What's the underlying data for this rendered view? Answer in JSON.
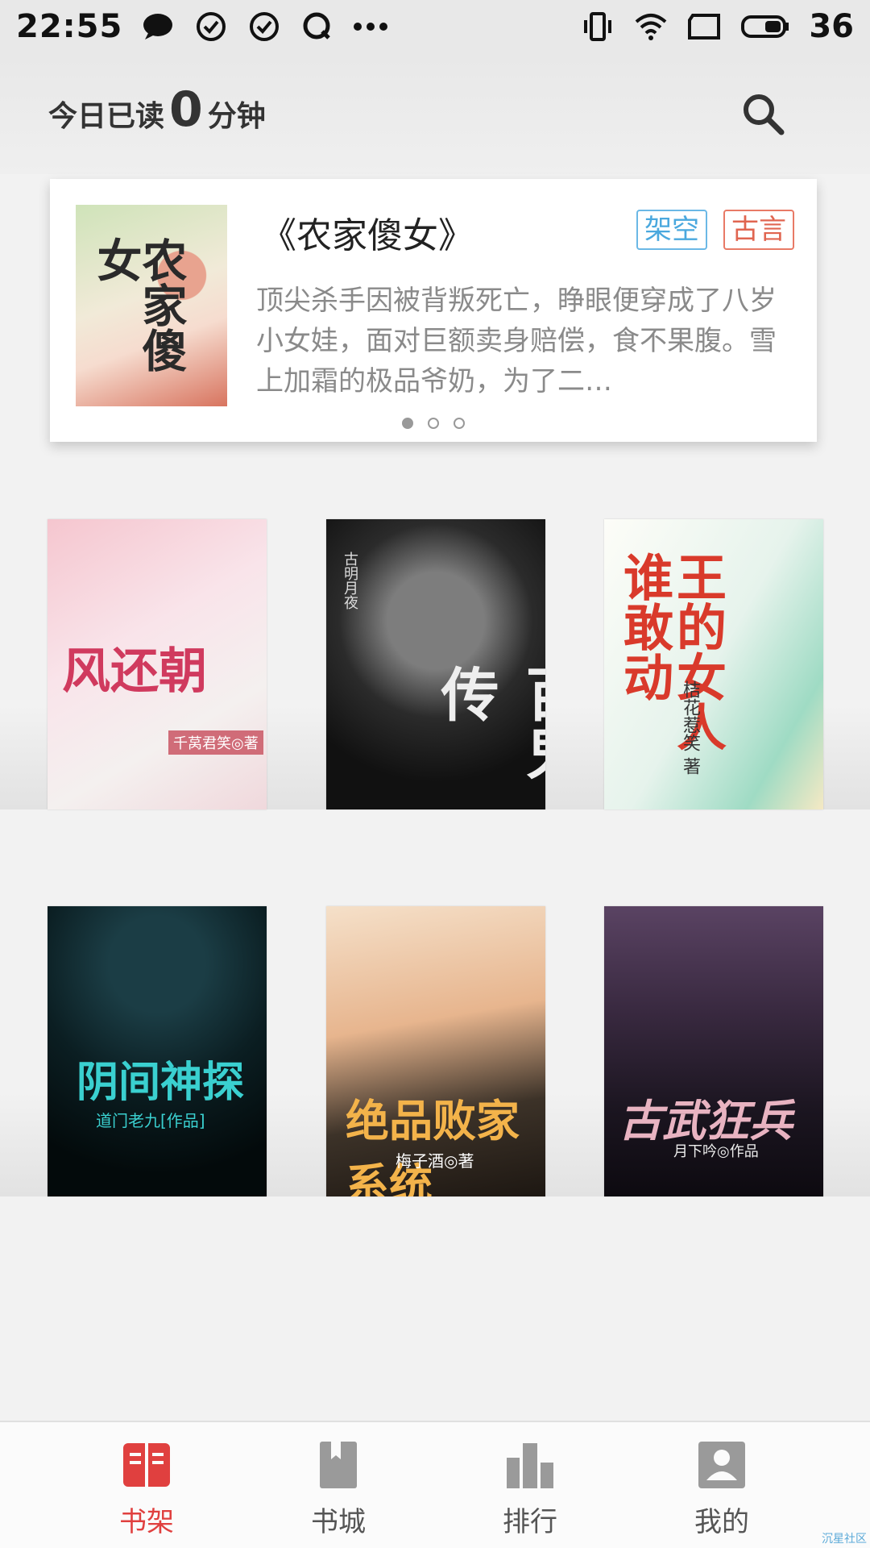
{
  "status_bar": {
    "time": "22:55",
    "battery_level": "36",
    "icons_left": [
      "chat-bubble-icon",
      "check-circle-icon",
      "check-circle-icon",
      "q-notification-icon",
      "more-dots-icon"
    ],
    "icons_right": [
      "vibrate-icon",
      "wifi-icon",
      "screen-rotate-icon",
      "battery-icon"
    ]
  },
  "header": {
    "reading_prefix": "今日已读",
    "reading_minutes": "0",
    "reading_suffix": "分钟",
    "search_icon": "search-icon"
  },
  "featured": {
    "title": "《农家傻女》",
    "cover_text": "农家傻女",
    "tags": [
      {
        "label": "架空",
        "color": "#4aa8de"
      },
      {
        "label": "古言",
        "color": "#e06550"
      }
    ],
    "description": "顶尖杀手因被背叛死亡，睁眼便穿成了八岁小女娃，面对巨额卖身赔偿，食不果腹。雪上加霜的极品爷奶，为了二…",
    "carousel_total": 3,
    "carousel_active": 1
  },
  "shelf": {
    "books": [
      {
        "cover_title": "风还朝",
        "cover_author": "千莴君笑◎著"
      },
      {
        "cover_title": "百鬼传",
        "cover_author": "古明月夜"
      },
      {
        "cover_title": "王的女人谁敢动",
        "cover_author": "桔花惹笑 著"
      },
      {
        "cover_title": "阴间神探",
        "cover_author": "道门老九[作品]"
      },
      {
        "cover_title": "绝品败家系统",
        "cover_author": "梅子酒◎著"
      },
      {
        "cover_title": "古武狂兵",
        "cover_author": "月下吟◎作品"
      }
    ]
  },
  "bottom_nav": {
    "active_color": "#e0403f",
    "items": [
      {
        "label": "书架",
        "icon": "bookshelf-icon"
      },
      {
        "label": "书城",
        "icon": "bookstore-icon"
      },
      {
        "label": "排行",
        "icon": "ranking-icon"
      },
      {
        "label": "我的",
        "icon": "profile-icon"
      }
    ]
  },
  "watermark": "沉星社区"
}
